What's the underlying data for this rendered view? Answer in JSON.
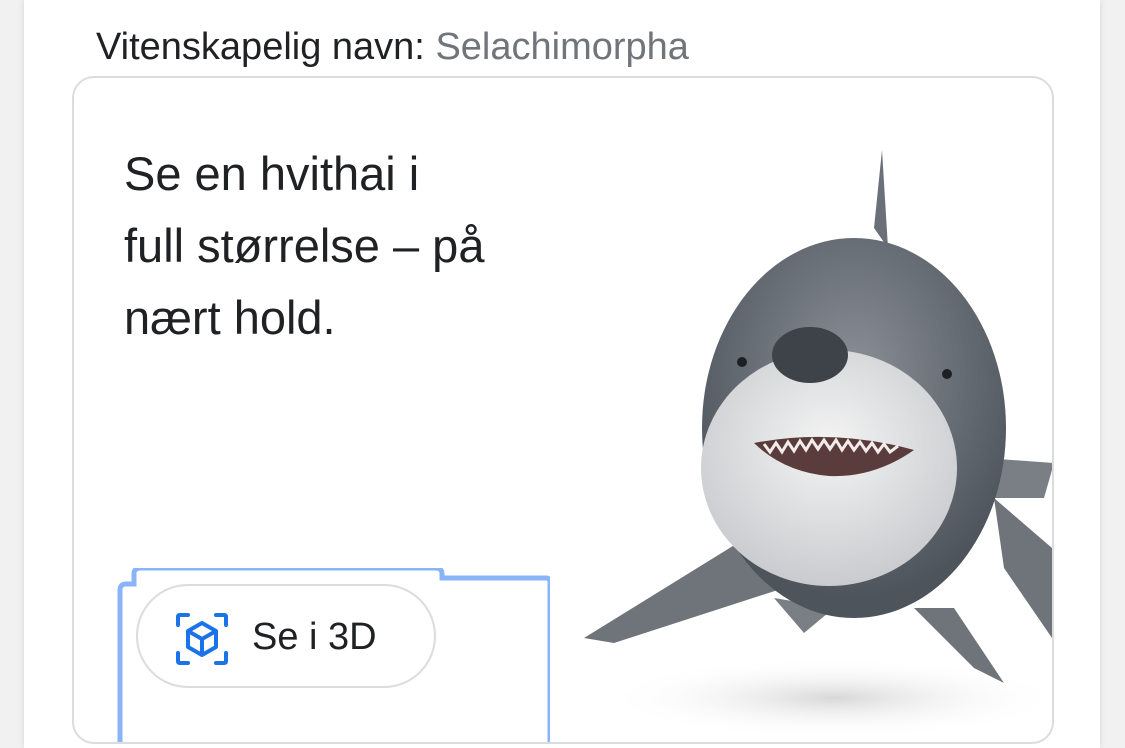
{
  "scientific_name": {
    "label": "Vitenskapelig navn:",
    "value": "Selachimorpha"
  },
  "promo": {
    "text_line1": "Se en hvithai i",
    "text_line2": "full størrelse – på",
    "text_line3": "nært hold.",
    "view_3d_label": "Se i 3D",
    "view_3d_icon": "3d-cube-icon",
    "image_subject": "white-shark-3d-model"
  },
  "colors": {
    "accent_blue": "#1a73e8",
    "focus_ring": "#8ab4f8",
    "text_primary": "#202124",
    "text_secondary": "#70757a",
    "border": "#dadce0"
  }
}
